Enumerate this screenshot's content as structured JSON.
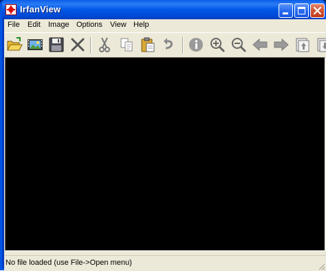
{
  "window": {
    "title": "IrfanView"
  },
  "menu": {
    "items": [
      "File",
      "Edit",
      "Image",
      "Options",
      "View",
      "Help"
    ]
  },
  "toolbar": {
    "buttons": [
      {
        "icon": "open-folder-icon"
      },
      {
        "icon": "slideshow-icon"
      },
      {
        "icon": "save-icon"
      },
      {
        "icon": "delete-icon"
      },
      {
        "icon": "cut-icon"
      },
      {
        "icon": "copy-icon"
      },
      {
        "icon": "paste-icon"
      },
      {
        "icon": "undo-icon"
      },
      {
        "icon": "info-icon"
      },
      {
        "icon": "zoom-in-icon"
      },
      {
        "icon": "zoom-out-icon"
      },
      {
        "icon": "previous-arrow-icon"
      },
      {
        "icon": "next-arrow-icon"
      },
      {
        "icon": "first-file-icon"
      },
      {
        "icon": "last-file-icon"
      }
    ]
  },
  "status": {
    "text": "No file loaded (use File->Open menu)"
  },
  "colors": {
    "titlebar": "#0058E6",
    "chrome": "#ECE9D8",
    "viewer_background": "#000000"
  }
}
